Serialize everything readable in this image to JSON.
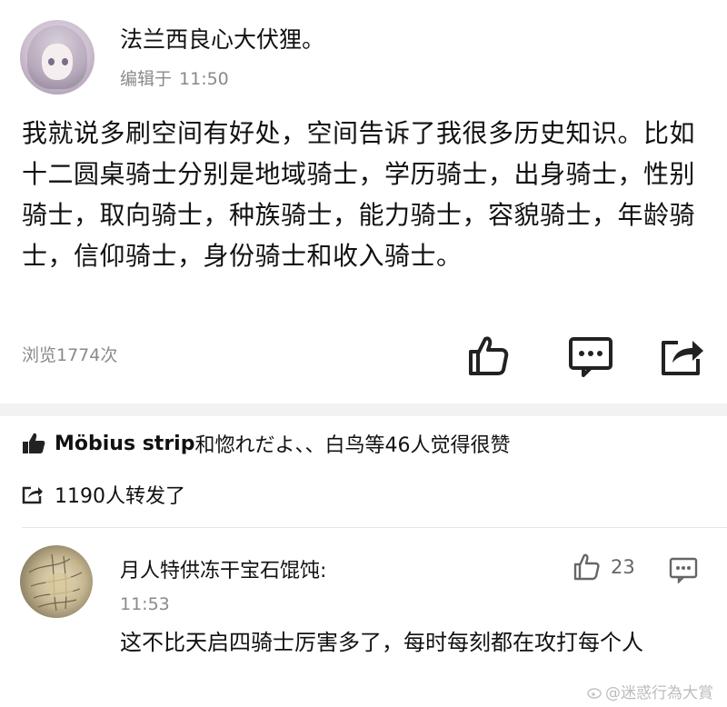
{
  "post": {
    "username": "法兰西良心大伏狸。",
    "edit_label": "编辑于",
    "edit_time": "11:50",
    "body": "我就说多刷空间有好处，空间告诉了我很多历史知识。比如十二圆桌骑士分别是地域骑士，学历骑士，出身骑士，性别骑士，取向骑士，种族骑士，能力骑士，容貌骑士，年龄骑士，信仰骑士，身份骑士和收入骑士。",
    "views": "浏览1774次"
  },
  "likes": {
    "names": "Möbius strip",
    "rest": "和惚れだよ、、白鸟等46人觉得很赞"
  },
  "shares": {
    "text": "1190人转发了"
  },
  "comment": {
    "author": "月人特供冻干宝石馄饨:",
    "time": "11:53",
    "like_count": "23",
    "body": "这不比天启四骑士厉害多了，每时每刻都在攻打每个人"
  },
  "watermark": "@迷惑行為大賞",
  "icons": [
    "thumbs-up-icon",
    "comment-icon",
    "share-icon",
    "small-thumbs-up-icon",
    "forward-icon",
    "reply-icon",
    "weibo-icon"
  ],
  "colors": {
    "text": "#111111",
    "muted": "#8a8a8a",
    "divider": "#f2f2f2"
  }
}
